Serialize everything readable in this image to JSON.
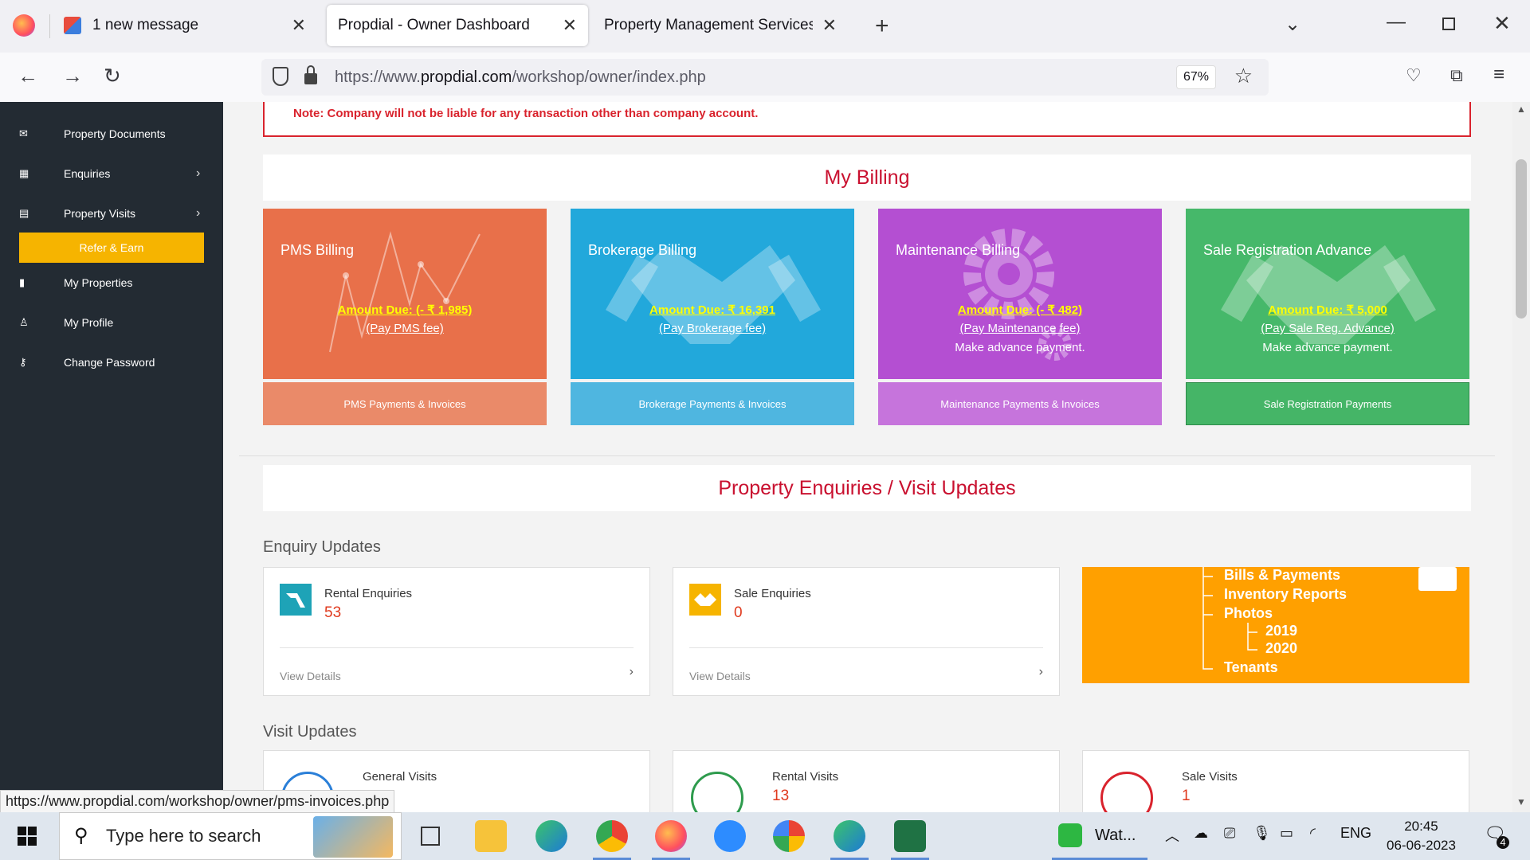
{
  "browser": {
    "tabs": [
      {
        "label": "1 new message"
      },
      {
        "label": "Propdial - Owner Dashboard"
      },
      {
        "label": "Property Management Services Pun"
      }
    ],
    "url_prefix": "https://www.",
    "url_domain": "propdial.com",
    "url_path": "/workshop/owner/index.php",
    "zoom": "67%",
    "status_url": "https://www.propdial.com/workshop/owner/pms-invoices.php"
  },
  "sidebar": {
    "items": [
      {
        "label": "Property Documents"
      },
      {
        "label": "Enquiries"
      },
      {
        "label": "Property Visits"
      },
      {
        "label": "Refer & Earn"
      },
      {
        "label": "My Properties"
      },
      {
        "label": "My Profile"
      },
      {
        "label": "Change Password"
      }
    ]
  },
  "note": "Note: Company will not be liable for any transaction other than company account.",
  "billing": {
    "title": "My Billing",
    "cards": [
      {
        "title": "PMS Billing",
        "due": "Amount Due: (- ₹ 1,985)",
        "pay": "(Pay PMS fee)",
        "advance": "",
        "footer": "PMS Payments & Invoices",
        "color": "#e8704a",
        "footer_color": "#ea8a69"
      },
      {
        "title": "Brokerage Billing",
        "due": "Amount Due: ₹ 16,391",
        "pay": "(Pay Brokerage fee)",
        "advance": "",
        "footer": "Brokerage Payments & Invoices",
        "color": "#22a8db",
        "footer_color": "#4fb6e0"
      },
      {
        "title": "Maintenance Billing",
        "due": "Amount Due: (- ₹ 482)",
        "pay": "(Pay Maintenance fee)",
        "advance": "Make advance payment.",
        "footer": "Maintenance Payments & Invoices",
        "color": "#b44fd2",
        "footer_color": "#c674dc"
      },
      {
        "title": "Sale Registration Advance",
        "due": "Amount Due: ₹ 5,000",
        "pay": "(Pay Sale Reg. Advance)",
        "advance": "Make advance payment.",
        "footer": "Sale Registration Payments",
        "color": "#46b86a",
        "footer_color": "#45b567"
      }
    ]
  },
  "enquiries_section": {
    "title": "Property Enquiries / Visit Updates",
    "enquiry_updates": "Enquiry Updates",
    "visit_updates": "Visit Updates",
    "enquiry_cards": [
      {
        "label": "Rental Enquiries",
        "count": "53",
        "view": "View Details"
      },
      {
        "label": "Sale Enquiries",
        "count": "0",
        "view": "View Details"
      }
    ],
    "tree": {
      "items": [
        "Bills & Payments",
        "Inventory Reports",
        "Photos",
        "2019",
        "2020",
        "Tenants"
      ]
    },
    "visit_cards": [
      {
        "label": "General Visits",
        "count": ""
      },
      {
        "label": "Rental Visits",
        "count": "13"
      },
      {
        "label": "Sale Visits",
        "count": "1"
      }
    ]
  },
  "taskbar": {
    "search_placeholder": "Type here to search",
    "whatsapp": "Wat...",
    "language": "ENG",
    "time": "20:45",
    "date": "06-06-2023",
    "notifications": "4"
  }
}
